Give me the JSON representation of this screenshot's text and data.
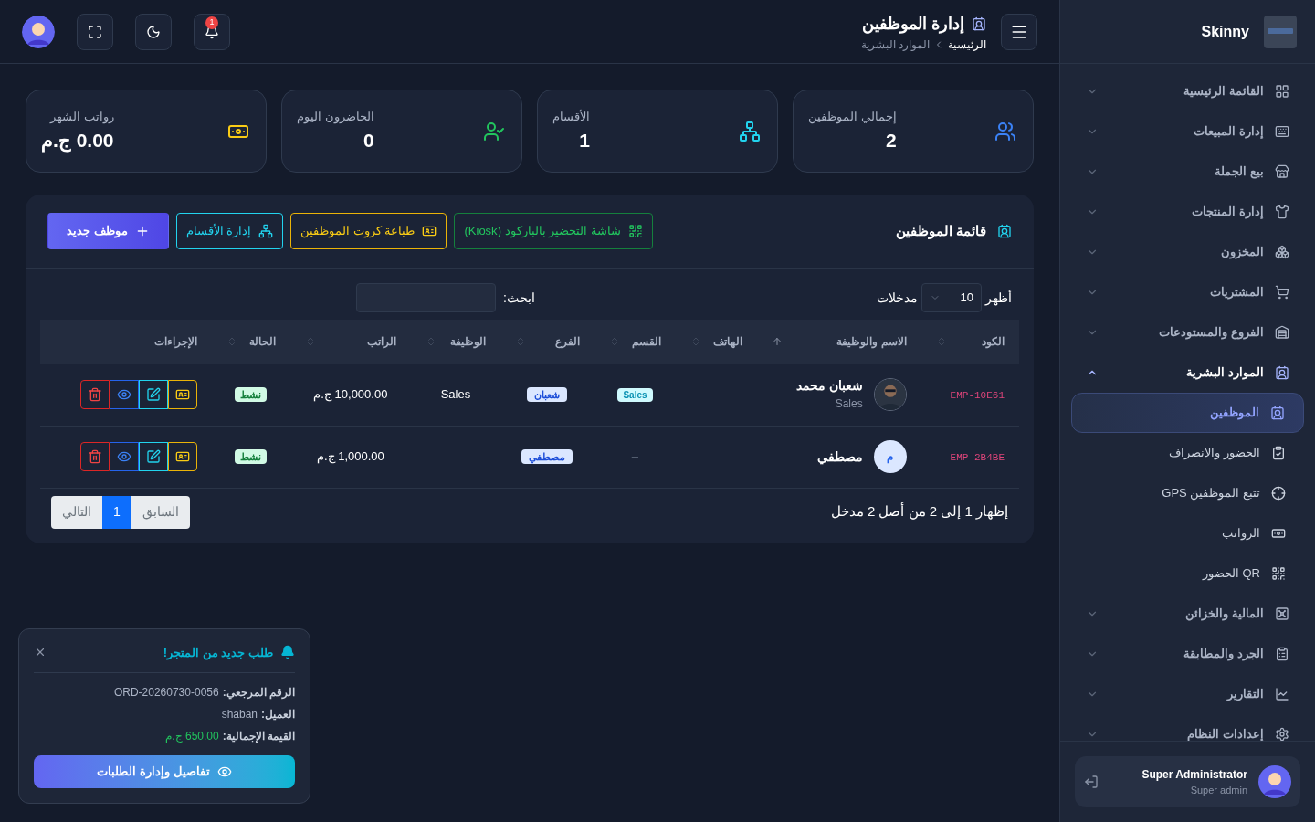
{
  "sidebar": {
    "brand": "Skinny",
    "items": [
      {
        "label": "القائمة الرئيسية",
        "expanded": false,
        "selected": false
      },
      {
        "label": "إدارة المبيعات",
        "expanded": false,
        "selected": false
      },
      {
        "label": "بيع الجملة",
        "expanded": false,
        "selected": false
      },
      {
        "label": "إدارة المنتجات",
        "expanded": false,
        "selected": false
      },
      {
        "label": "المخزون",
        "expanded": false,
        "selected": false
      },
      {
        "label": "المشتريات",
        "expanded": false,
        "selected": false
      },
      {
        "label": "الفروع والمستودعات",
        "expanded": false,
        "selected": false
      },
      {
        "label": "الموارد البشرية",
        "expanded": true,
        "selected": true,
        "children": [
          {
            "label": "الموظفين",
            "selected": true
          },
          {
            "label": "الحضور والانصراف",
            "selected": false
          },
          {
            "label": "تتبع الموظفين GPS",
            "selected": false
          },
          {
            "label": "الرواتب",
            "selected": false
          },
          {
            "label": "QR الحضور",
            "selected": false
          }
        ]
      },
      {
        "label": "المالية والخزائن",
        "expanded": false,
        "selected": false
      },
      {
        "label": "الجرد والمطابقة",
        "expanded": false,
        "selected": false
      },
      {
        "label": "التقارير",
        "expanded": false,
        "selected": false
      },
      {
        "label": "إعدادات النظام",
        "expanded": false,
        "selected": false
      }
    ],
    "user": {
      "name": "Super Administrator",
      "role": "Super admin"
    }
  },
  "header": {
    "title": "إدارة الموظفين",
    "breadcrumb": [
      "الرئيسية",
      "الموارد البشرية"
    ],
    "notification_count": "1"
  },
  "stats": [
    {
      "label": "إجمالي الموظفين",
      "value": "2",
      "color": "#3b82f6"
    },
    {
      "label": "الأقسام",
      "value": "1",
      "color": "#22d3ee"
    },
    {
      "label": "الحاضرون اليوم",
      "value": "0",
      "color": "#22c55e"
    },
    {
      "label": "رواتب الشهر",
      "value": "0.00 ج.م",
      "color": "#facc15"
    }
  ],
  "panel": {
    "title": "قائمة الموظفين",
    "buttons": [
      {
        "kind": "kiosk",
        "label": "شاشة التحضير بالباركود (Kiosk)"
      },
      {
        "kind": "print",
        "label": "طباعة كروت الموظفين"
      },
      {
        "kind": "departments",
        "label": "إدارة الأقسام"
      },
      {
        "kind": "add",
        "label": "موظف جديد"
      }
    ],
    "length": {
      "before": "أظهر",
      "value": "10",
      "after": "مدخلات"
    },
    "search": {
      "label": "ابحث:"
    },
    "columns": [
      {
        "label": "الكود",
        "sortable": true,
        "sorted": false
      },
      {
        "label": "الاسم والوظيفة",
        "sortable": true,
        "sorted": true
      },
      {
        "label": "الهاتف",
        "sortable": true,
        "sorted": false
      },
      {
        "label": "القسم",
        "sortable": true,
        "sorted": false
      },
      {
        "label": "الفرع",
        "sortable": true,
        "sorted": false
      },
      {
        "label": "الوظيفة",
        "sortable": true,
        "sorted": false
      },
      {
        "label": "الراتب",
        "sortable": true,
        "sorted": false
      },
      {
        "label": "الحالة",
        "sortable": true,
        "sorted": false
      },
      {
        "label": "الإجراءات",
        "sortable": false
      }
    ],
    "rows": [
      {
        "code": "EMP-10E61",
        "name": "شعبان محمد",
        "subtitle": "Sales",
        "department": {
          "kind": "badge",
          "text": "Sales"
        },
        "branch": "شعبان",
        "job": "Sales",
        "salary": "10,000.00 ج.م",
        "status": "نشط"
      },
      {
        "code": "EMP-2B4BE",
        "avatar": {
          "kind": "initial",
          "text": "م"
        },
        "name": "مصطفي",
        "department": {
          "kind": "dash",
          "text": "–"
        },
        "branch": "مصطفي",
        "salary": "1,000.00 ج.م",
        "status": "نشط"
      }
    ],
    "info": "إظهار 1 إلى 2 من أصل 2 مدخل",
    "pagination": [
      {
        "label": "السابق",
        "selected": false
      },
      {
        "label": "1",
        "selected": true
      },
      {
        "label": "التالي",
        "selected": false
      }
    ]
  },
  "toast": {
    "title": "طلب جديد من المتجر!",
    "lines": [
      {
        "label": "الرقم المرجعي:",
        "value": "ORD-20260730-0056",
        "kind": "plain"
      },
      {
        "label": "العميل:",
        "value": "shaban",
        "kind": "plain"
      },
      {
        "label": "القيمة الإجمالية:",
        "value": "650.00 ج.م",
        "kind": "money"
      }
    ],
    "button": "تفاصيل وإدارة الطلبات"
  }
}
